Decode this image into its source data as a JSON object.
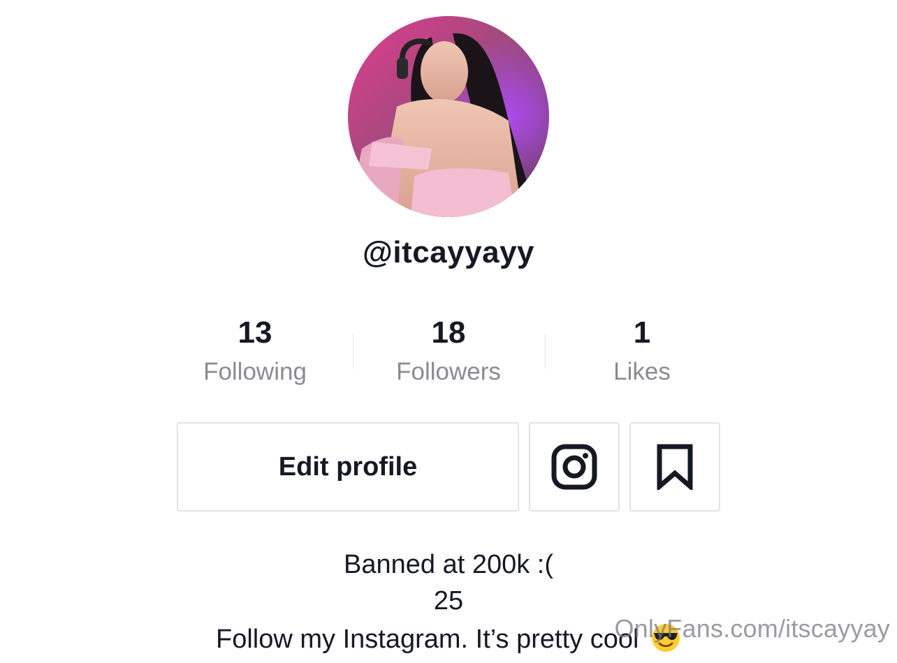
{
  "profile": {
    "username": "@itcayyayy",
    "avatar_icon": "profile-photo"
  },
  "stats": {
    "following": {
      "value": "13",
      "label": "Following"
    },
    "followers": {
      "value": "18",
      "label": "Followers"
    },
    "likes": {
      "value": "1",
      "label": "Likes"
    }
  },
  "actions": {
    "edit_profile_label": "Edit profile",
    "instagram_icon": "instagram-icon",
    "bookmark_icon": "bookmark-icon"
  },
  "bio": {
    "line1": "Banned at 200k :(",
    "line2": "25",
    "line3": "Follow my Instagram. It’s pretty cool",
    "line3_emoji": "smiling-face-with-sunglasses"
  },
  "watermark": {
    "text": "OnlyFans.com/itscayyay"
  },
  "colors": {
    "text_primary": "#161823",
    "text_secondary": "#8a8b91",
    "border": "#e3e3e4"
  }
}
